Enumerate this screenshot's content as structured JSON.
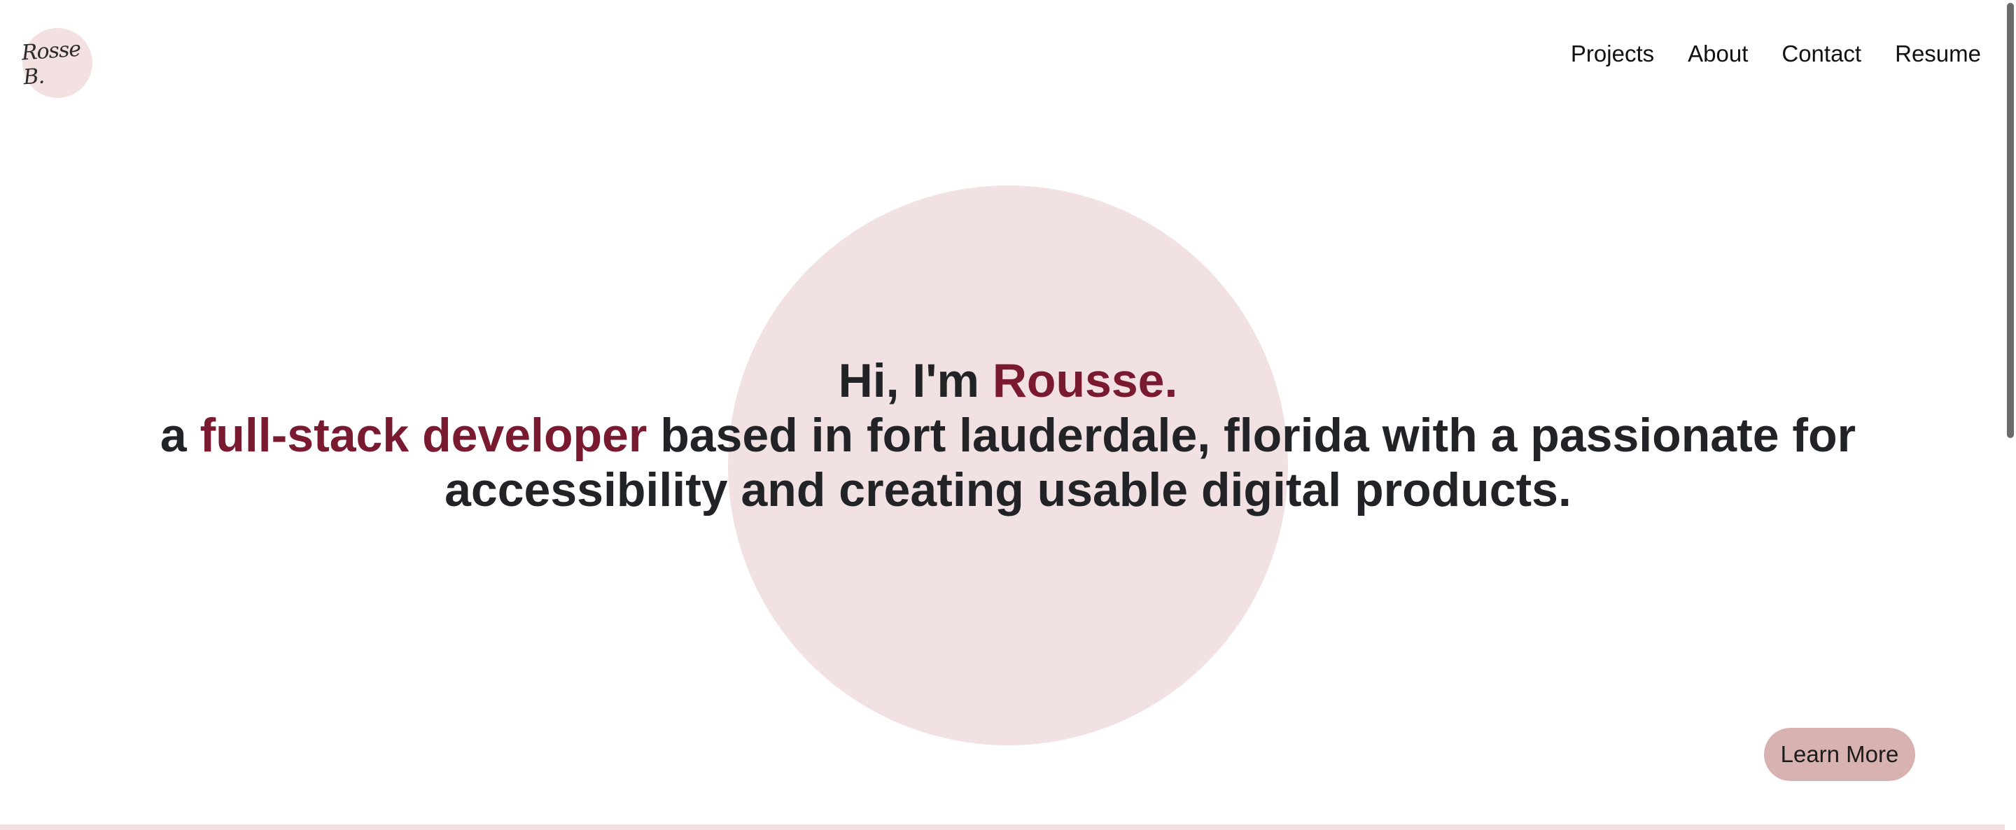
{
  "logo": {
    "text": "Rosse B."
  },
  "nav": {
    "items": [
      {
        "label": "Projects"
      },
      {
        "label": "About"
      },
      {
        "label": "Contact"
      },
      {
        "label": "Resume"
      }
    ]
  },
  "hero": {
    "greeting_prefix": "Hi, I'm ",
    "name": "Rousse.",
    "line2_prefix": "a ",
    "role": "full-stack developer",
    "line2_suffix": " based in fort lauderdale, florida with a passionate for",
    "line3": "accessibility and creating usable digital products."
  },
  "cta": {
    "learn_more_label": "Learn More"
  },
  "colors": {
    "accent": "#7a1a31",
    "circle": "#f2e1e2",
    "button": "#d8b1b1",
    "text": "#222326"
  }
}
